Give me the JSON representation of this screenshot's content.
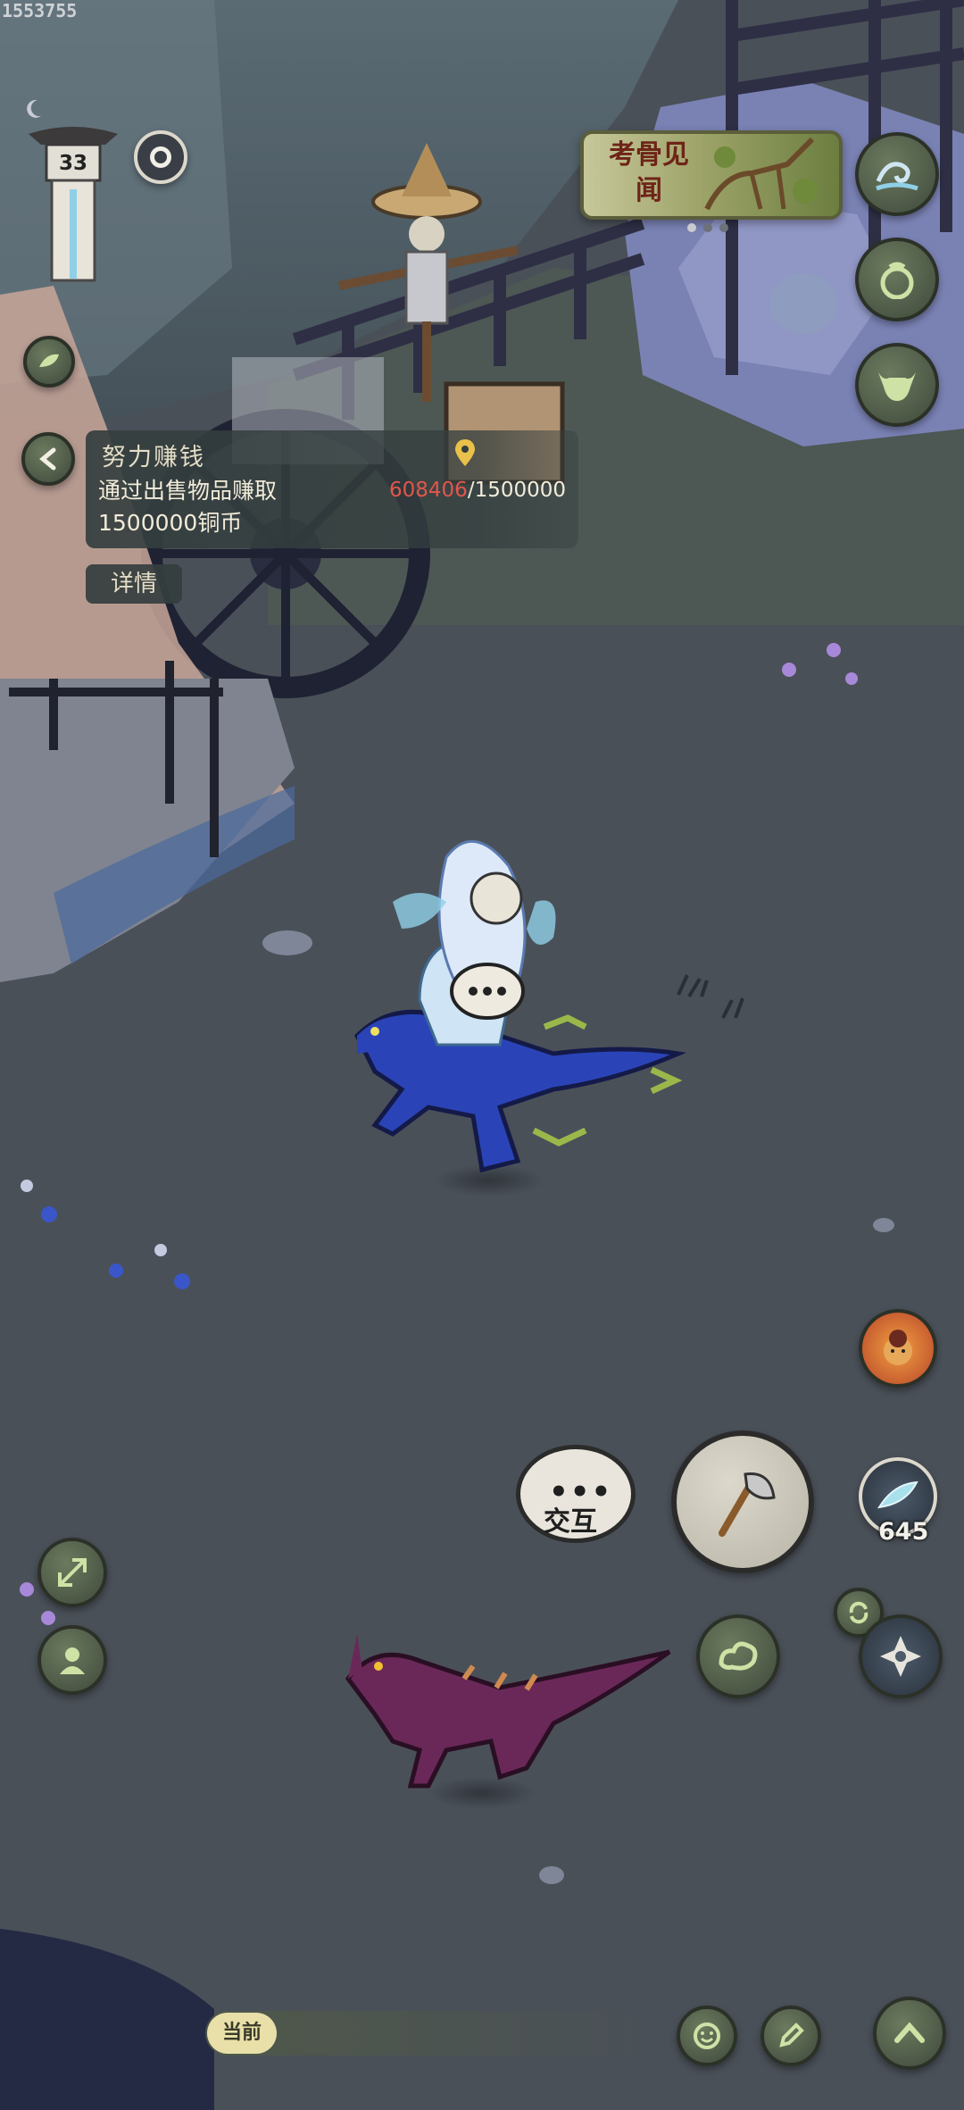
{
  "id_watermark": "1553755",
  "player": {
    "level": "33"
  },
  "quest": {
    "title": "努力赚钱",
    "description": "通过出售物品赚取1500000铜币",
    "progress_current": "608406",
    "progress_separator": "/",
    "progress_target": "1500000",
    "details_label": "详情",
    "current_color": "#e2564c"
  },
  "event_banner": {
    "text": "考骨见闻",
    "pages": 3,
    "active_page": 1
  },
  "actions": {
    "interact_label": "交互",
    "resource_count": "645"
  },
  "bottom_bar": {
    "current_label": "当前"
  },
  "icons": {
    "level_marker": "lantern-pillar-icon",
    "moon": "moon-icon",
    "time": "day-night-icon",
    "back": "chevron-left-icon",
    "leaf": "leaf-icon",
    "location": "location-pin-icon",
    "wave": "wave-icon",
    "pouch": "pouch-icon",
    "ox": "ox-head-icon",
    "buddha": "buddha-portrait-icon",
    "axe": "axe-icon",
    "feather": "feather-icon",
    "refresh": "refresh-icon",
    "compass": "compass-icon",
    "cloud": "cloud-swirl-icon",
    "expand": "expand-arrows-icon",
    "character": "character-portrait-icon",
    "emote": "smile-icon",
    "edit": "edit-icon",
    "up": "chevron-up-icon"
  }
}
